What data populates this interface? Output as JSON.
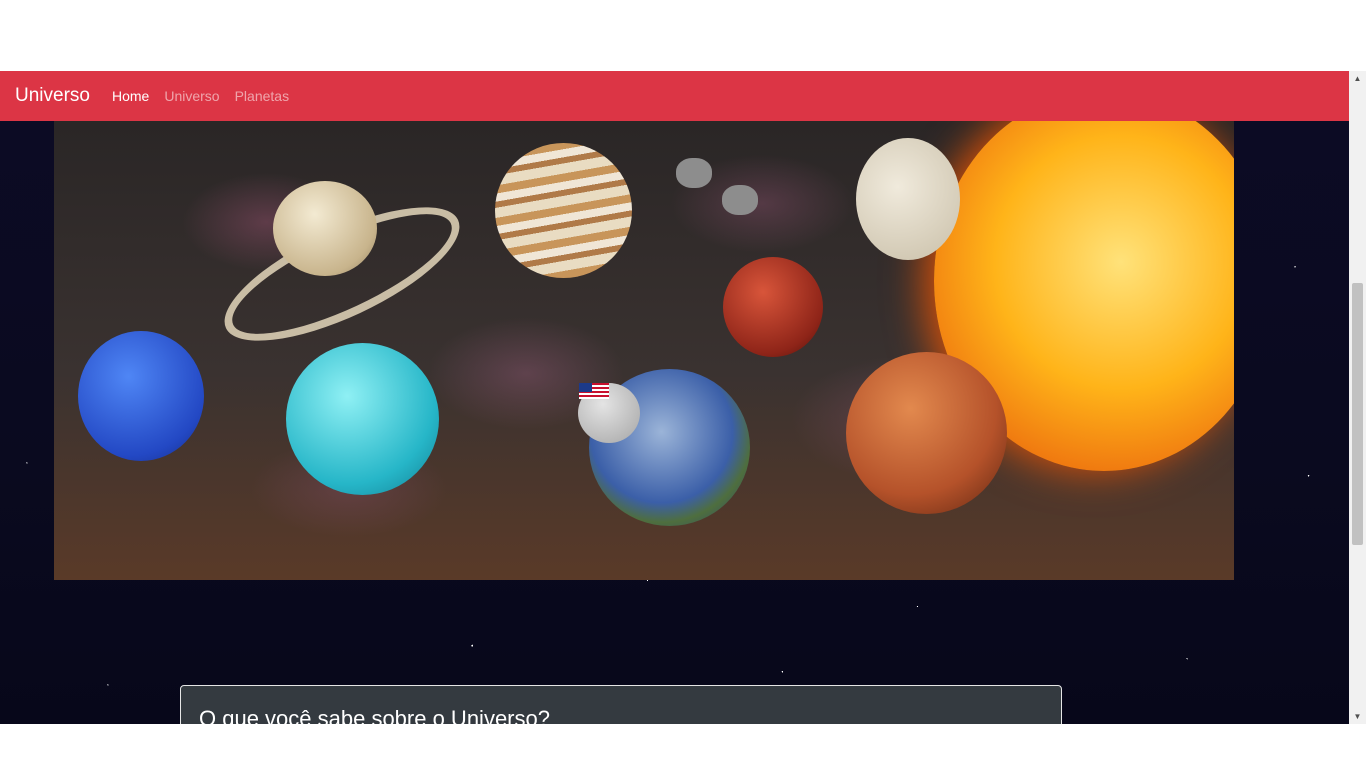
{
  "navbar": {
    "brand": "Universo",
    "links": [
      {
        "label": "Home",
        "active": true
      },
      {
        "label": "Universo",
        "active": false
      },
      {
        "label": "Planetas",
        "active": false
      }
    ],
    "color": "#dc3545"
  },
  "hero": {
    "icon": "solar-system-image"
  },
  "card": {
    "title": "O que você sabe sobre o Universo?"
  },
  "colors": {
    "background": "#0a0a1f",
    "card": "#343a40"
  }
}
